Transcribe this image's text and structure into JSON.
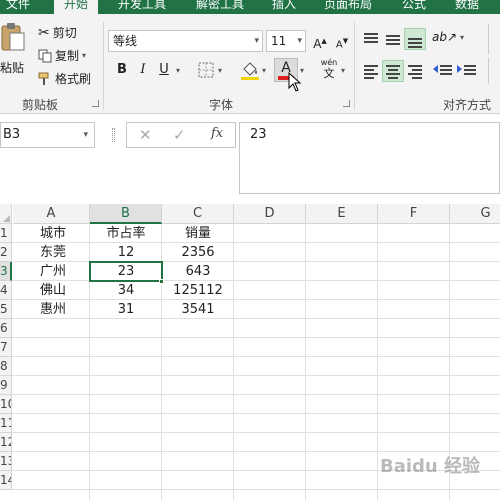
{
  "ribbon_tabs": [
    {
      "label": "文件"
    },
    {
      "label": "开始"
    },
    {
      "label": "开发工具"
    },
    {
      "label": "解密工具"
    },
    {
      "label": "插入"
    },
    {
      "label": "页面布局"
    },
    {
      "label": "公式"
    },
    {
      "label": "数据"
    }
  ],
  "clipboard": {
    "paste_label": "粘贴",
    "cut_label": "剪切",
    "copy_label": "复制",
    "format_painter_label": "格式刷",
    "group_label": "剪贴板"
  },
  "font": {
    "font_name": "等线",
    "font_size": "11",
    "bold": "B",
    "italic": "I",
    "underline": "U",
    "phonetic_top": "wén",
    "phonetic_bottom": "文",
    "group_label": "字体",
    "fill_color": "#f2d600",
    "font_color": "#e02020"
  },
  "alignment": {
    "group_label": "对齐方式"
  },
  "formula_bar": {
    "name_box": "B3",
    "fx_label": "fx",
    "content": "23"
  },
  "columns": [
    "A",
    "B",
    "C",
    "D",
    "E",
    "F",
    "G"
  ],
  "rows": [
    "1",
    "2",
    "3",
    "4",
    "5",
    "6",
    "7",
    "8",
    "9",
    "10",
    "11",
    "12",
    "13",
    "14"
  ],
  "table": {
    "headers": [
      "城市",
      "市占率",
      "销量"
    ],
    "data": [
      [
        "东莞",
        "12",
        "2356"
      ],
      [
        "广州",
        "23",
        "643"
      ],
      [
        "佛山",
        "34",
        "125112"
      ],
      [
        "惠州",
        "31",
        "3541"
      ]
    ]
  },
  "selected_cell": "B3",
  "accent_color": "#217346",
  "watermark": "Baidu 经验"
}
